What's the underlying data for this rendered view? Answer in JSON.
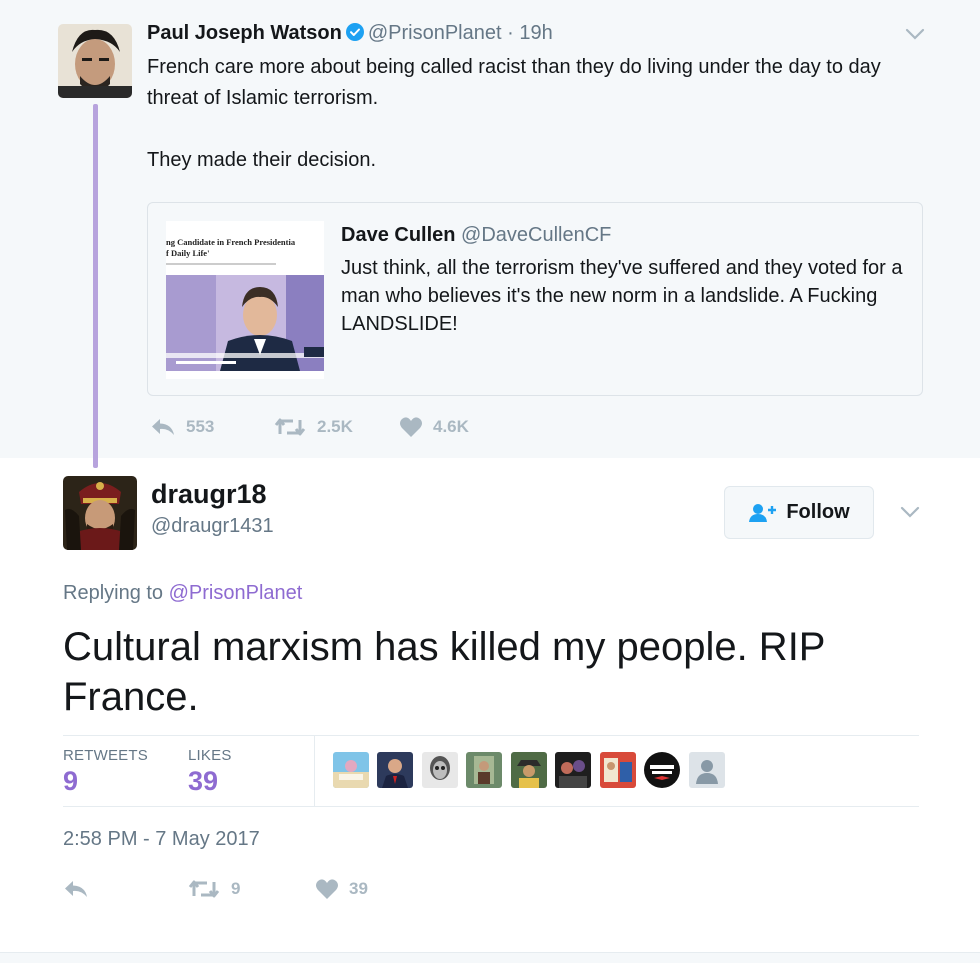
{
  "parent_tweet": {
    "author_name": "Paul Joseph Watson",
    "verified_icon": "verified-badge-icon",
    "handle": "@PrisonPlanet",
    "separator": "·",
    "time": "19h",
    "text_paragraph_1": "French care more about being called racist than they do living under the day to day threat of Islamic terrorism.",
    "text_paragraph_2": "They made their decision.",
    "quoted": {
      "author_name": "Dave Cullen",
      "handle": "@DaveCullenCF",
      "text": "Just think, all the terrorism they've suffered and they voted for a man who believes it's the new norm in a landslide. A Fucking LANDSLIDE!",
      "media_caption_line_1": "ng Candidate in French Presidentia",
      "media_caption_line_2": "f Daily Life'"
    },
    "actions": {
      "reply_count": "553",
      "retweet_count": "2.5K",
      "like_count": "4.6K"
    }
  },
  "reply_tweet": {
    "author_name": "draugr18",
    "handle": "@draugr1431",
    "follow_label": "Follow",
    "replying_prefix": "Replying to",
    "replying_mention": "@PrisonPlanet",
    "text": "Cultural marxism has killed my people. RIP France.",
    "stats": {
      "retweets_label": "RETWEETS",
      "retweets_value": "9",
      "likes_label": "LIKES",
      "likes_value": "39"
    },
    "liker_avatars_count": 9,
    "timestamp": "2:58 PM - 7 May 2017",
    "actions": {
      "retweet_count": "9",
      "like_count": "39"
    }
  },
  "colors": {
    "accent_purple": "#8e6bd1",
    "thread_line": "#b7a3dd",
    "muted_text": "#657786",
    "icon_gray": "#aab8c2",
    "verified_blue": "#1da1f2"
  }
}
